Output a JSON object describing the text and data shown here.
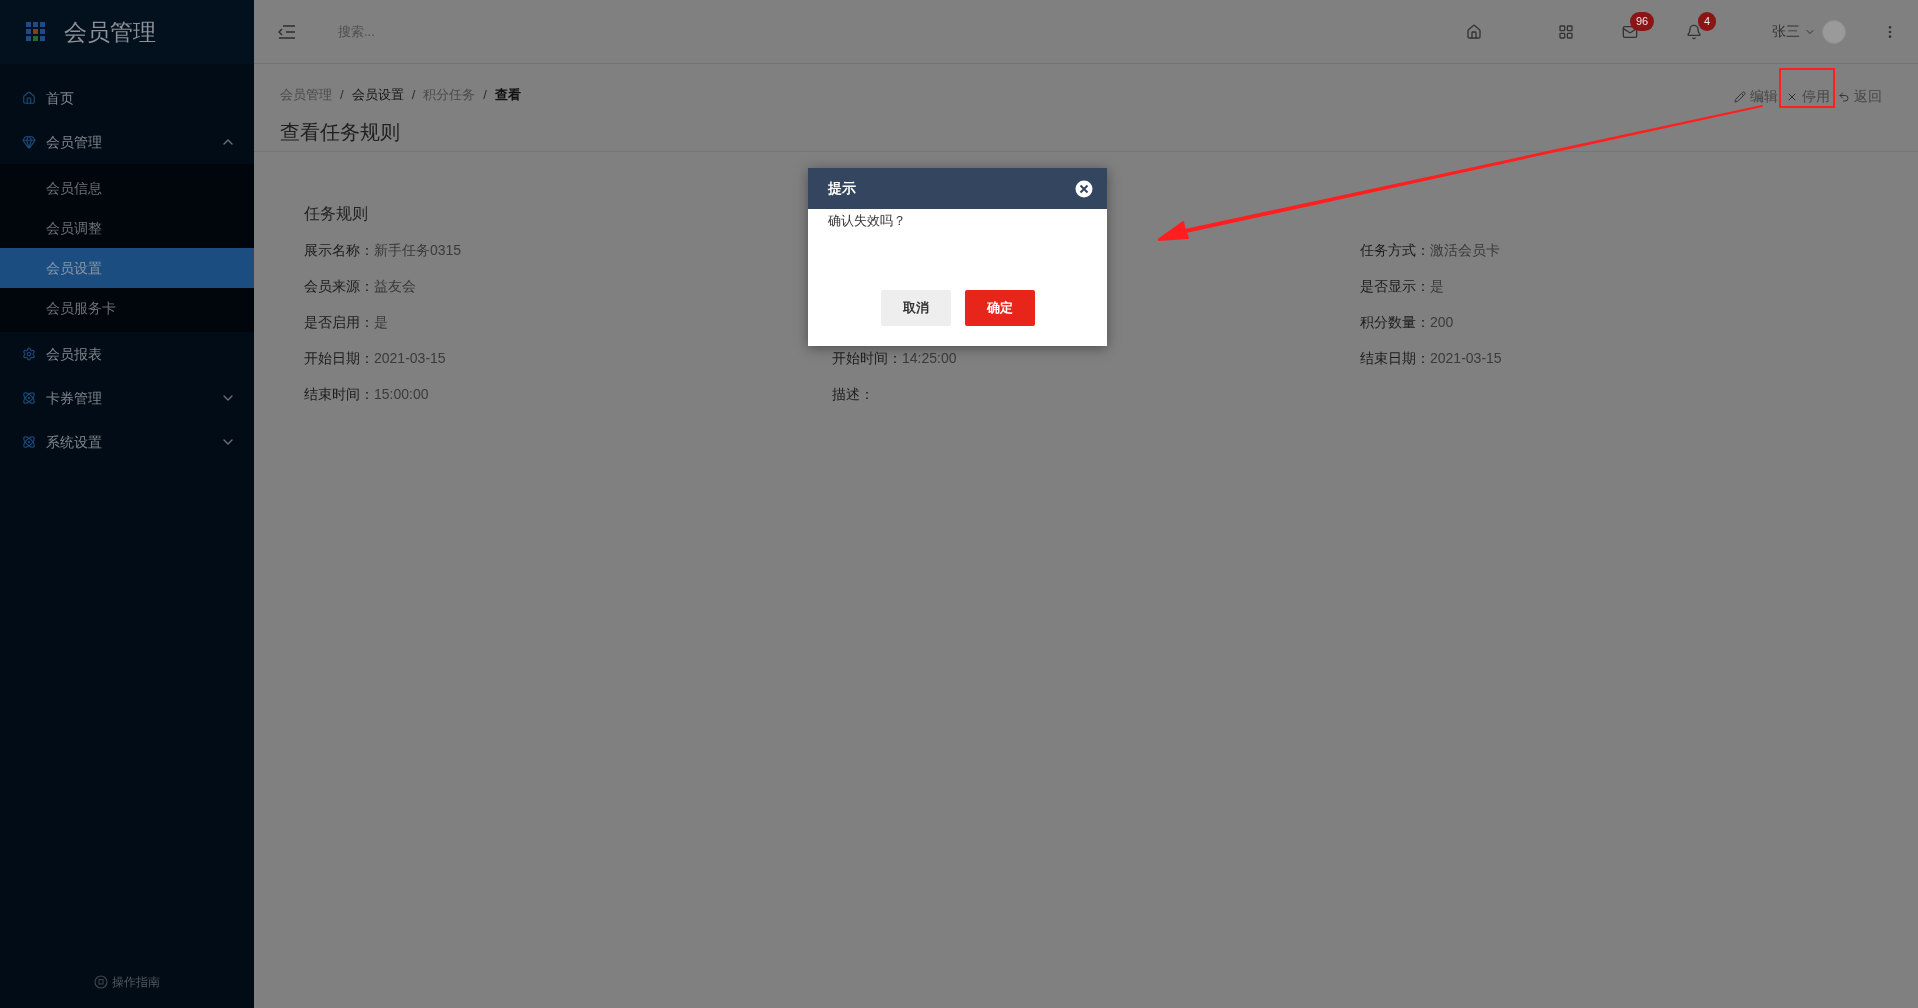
{
  "app": {
    "title": "会员管理"
  },
  "sidebar": {
    "items": [
      {
        "label": "首页"
      },
      {
        "label": "会员管理",
        "expanded": true,
        "children": [
          {
            "label": "会员信息",
            "selected": false
          },
          {
            "label": "会员调整",
            "selected": false
          },
          {
            "label": "会员设置",
            "selected": true
          },
          {
            "label": "会员服务卡",
            "selected": false
          }
        ]
      },
      {
        "label": "会员报表"
      },
      {
        "label": "卡券管理",
        "expanded": false
      },
      {
        "label": "系统设置",
        "expanded": false
      }
    ],
    "footer": "操作指南"
  },
  "topbar": {
    "search": {
      "placeholder": "搜索..."
    },
    "mail_badge": "96",
    "bell_badge": "4",
    "user": "张三"
  },
  "breadcrumb": [
    {
      "label": "会员管理",
      "kind": "link"
    },
    {
      "separator": "/",
      "label": "会员设置",
      "kind": "active"
    },
    {
      "separator": "/",
      "label": "积分任务",
      "kind": "link"
    },
    {
      "separator": "/",
      "label": "查看",
      "kind": "current"
    }
  ],
  "actions": [
    "编辑",
    "停用",
    "返回"
  ],
  "page_title": "查看任务规则",
  "section_title": "任务规则",
  "columns": [
    [
      {
        "label": "展示名称：",
        "value": "新手任务0315"
      },
      {
        "label": "会员来源：",
        "value": "益友会"
      },
      {
        "label": "是否启用：",
        "value": "是"
      },
      {
        "label": "开始日期：",
        "value": "2021-03-15"
      },
      {
        "label": "结束时间：",
        "value": "15:00:00"
      }
    ],
    [
      {
        "label": "开始时间：",
        "value": "14:25:00"
      },
      {
        "label": "描述："
      }
    ],
    [
      {
        "label": "任务方式：",
        "value": "激活会员卡"
      },
      {
        "label": "是否显示：",
        "value": "是"
      },
      {
        "label": "积分数量：",
        "value": "200"
      },
      {
        "label": "结束日期：",
        "value": "2021-03-15"
      }
    ]
  ],
  "dialog": {
    "title": "提示",
    "message": "确认失效吗？",
    "buttons": [
      {
        "label": "取消",
        "kind": "cancel"
      },
      {
        "label": "确定",
        "kind": "confirm"
      }
    ]
  }
}
